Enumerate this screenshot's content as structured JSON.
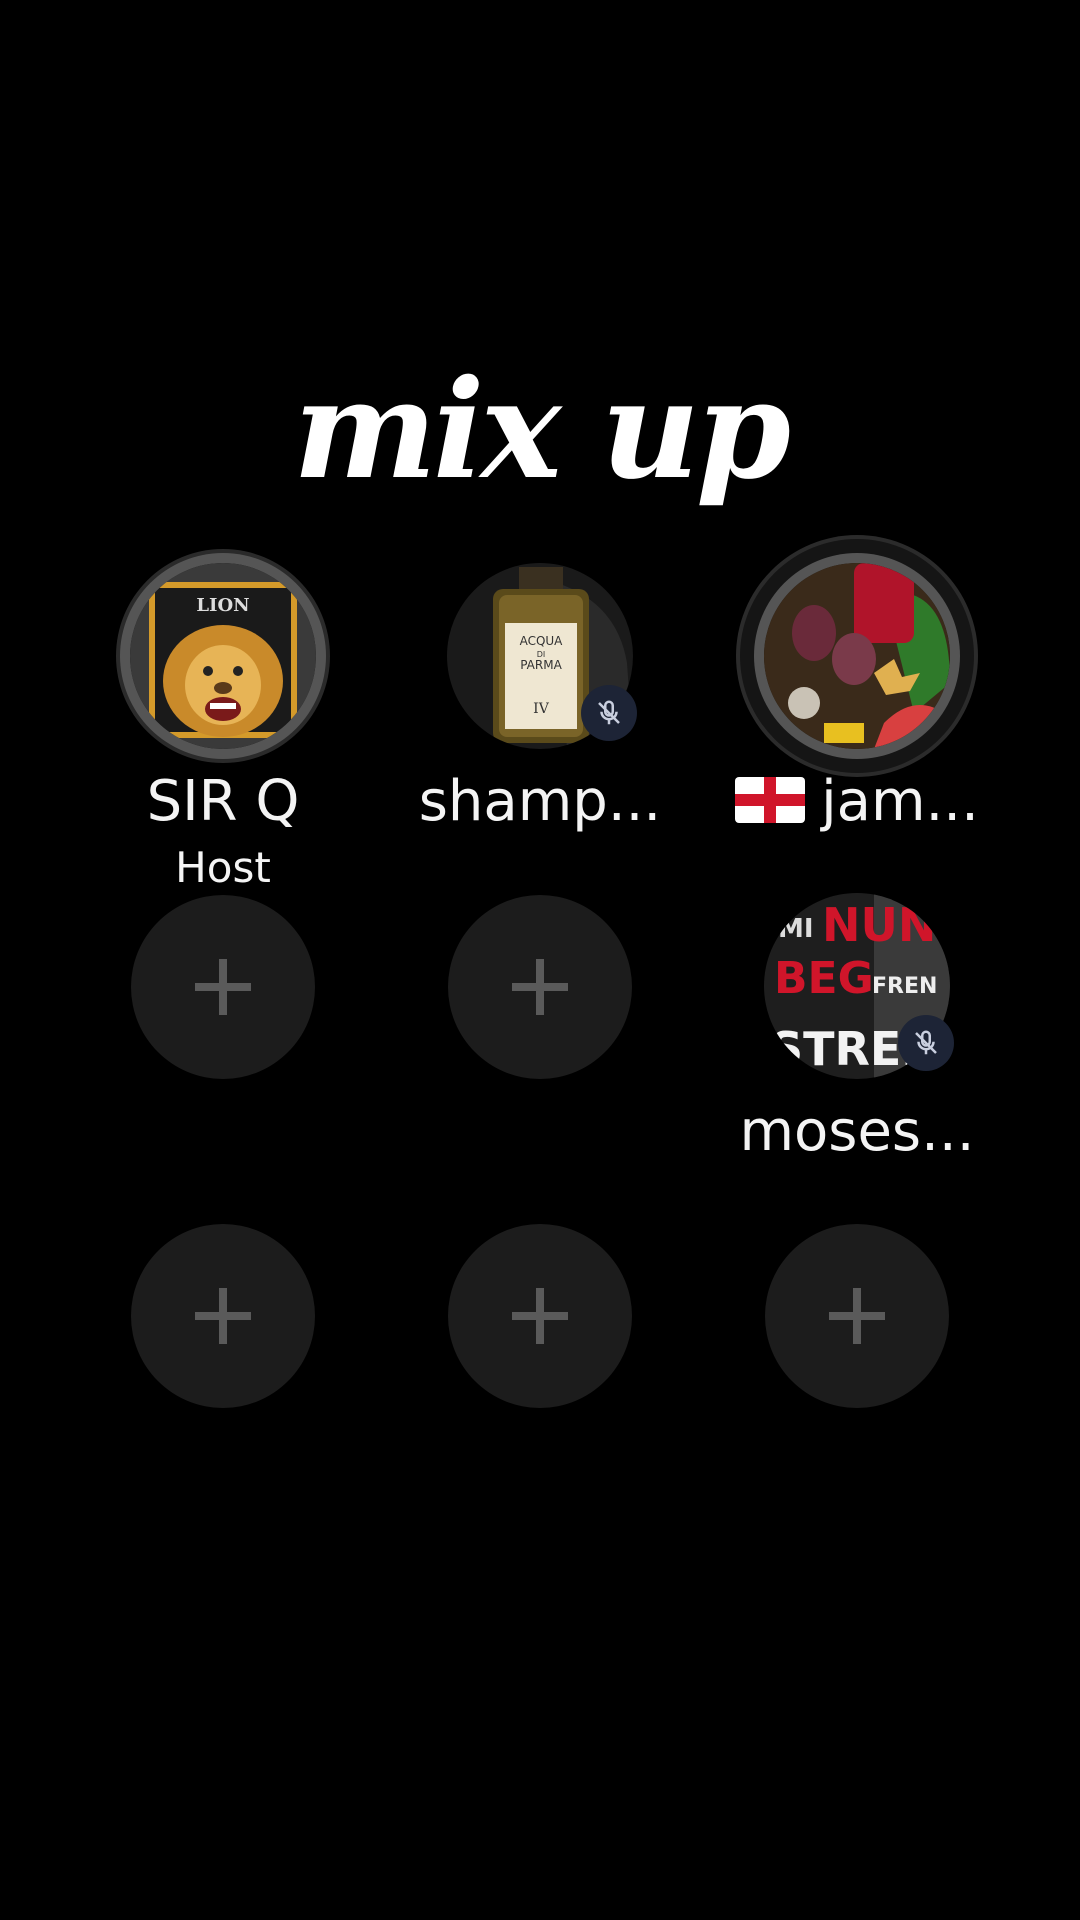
{
  "room": {
    "title": "mix up"
  },
  "seats": [
    {
      "name": "SIR Q",
      "role": "Host",
      "image_text": "LION"
    },
    {
      "name": "shamp...",
      "muted": true,
      "image_text": [
        "ACQUA",
        "DI",
        "PARMA",
        "IV"
      ]
    },
    {
      "flag": "england-flag-icon",
      "name": "jam..."
    },
    {
      "empty": true,
      "icon": "plus-icon"
    },
    {
      "empty": true,
      "icon": "plus-icon"
    },
    {
      "name": "moses...",
      "muted": true,
      "image_text": [
        "MI",
        "NUN",
        "BEG",
        "FREN",
        "STREE"
      ]
    },
    {
      "empty": true,
      "icon": "plus-icon"
    },
    {
      "empty": true,
      "icon": "plus-icon"
    },
    {
      "empty": true,
      "icon": "plus-icon"
    }
  ],
  "colors": {
    "background": "#000000",
    "empty_seat": "#1c1c1c",
    "plus": "#5a5a5a",
    "mute_badge": "#1d2436",
    "text": "#ffffff"
  }
}
